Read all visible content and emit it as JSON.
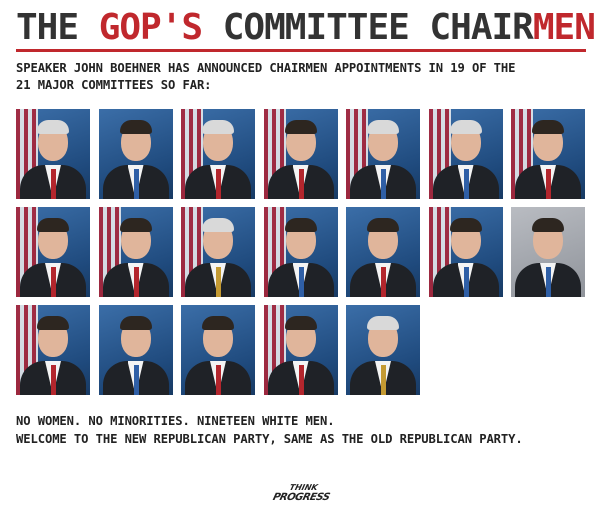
{
  "header": {
    "title_part1": "THE ",
    "title_part2": "GOP'S",
    "title_part3": " COMMITTEE CHAIR",
    "title_part4": "MEN",
    "subtitle_line1": "SPEAKER JOHN BOEHNER HAS ANNOUNCED CHAIRMEN APPOINTMENTS IN 19 OF THE",
    "subtitle_line2": "21 MAJOR COMMITTEES SO FAR:"
  },
  "colors": {
    "accent_red": "#c0282d",
    "text_dark": "#333333"
  },
  "portraits": [
    {
      "tie": "red",
      "hair": "light",
      "bg": "flag"
    },
    {
      "tie": "blue",
      "hair": "dark",
      "bg": "plain"
    },
    {
      "tie": "red",
      "hair": "light",
      "bg": "flag"
    },
    {
      "tie": "red",
      "hair": "dark",
      "bg": "flag"
    },
    {
      "tie": "blue",
      "hair": "light",
      "bg": "flag"
    },
    {
      "tie": "blue",
      "hair": "light",
      "bg": "flag"
    },
    {
      "tie": "red",
      "hair": "dark",
      "bg": "flag"
    },
    {
      "tie": "red",
      "hair": "dark",
      "bg": "flag"
    },
    {
      "tie": "red",
      "hair": "dark",
      "bg": "flag"
    },
    {
      "tie": "gold",
      "hair": "light",
      "bg": "flag"
    },
    {
      "tie": "blue",
      "hair": "dark",
      "bg": "flag"
    },
    {
      "tie": "red",
      "hair": "dark",
      "bg": "plain"
    },
    {
      "tie": "blue",
      "hair": "dark",
      "bg": "flag"
    },
    {
      "tie": "blue",
      "hair": "dark",
      "bg": "gray"
    },
    {
      "tie": "red",
      "hair": "dark",
      "bg": "flag"
    },
    {
      "tie": "blue",
      "hair": "dark",
      "bg": "plain"
    },
    {
      "tie": "red",
      "hair": "dark",
      "bg": "plain"
    },
    {
      "tie": "red",
      "hair": "dark",
      "bg": "flag"
    },
    {
      "tie": "gold",
      "hair": "light",
      "bg": "plain"
    }
  ],
  "footer": {
    "line1": "NO WOMEN. NO MINORITIES. NINETEEN WHITE MEN.",
    "line2": "WELCOME TO THE NEW REPUBLICAN PARTY, SAME AS THE OLD REPUBLICAN PARTY."
  },
  "logo": {
    "line1": "THINK",
    "line2": "PROGRESS"
  }
}
